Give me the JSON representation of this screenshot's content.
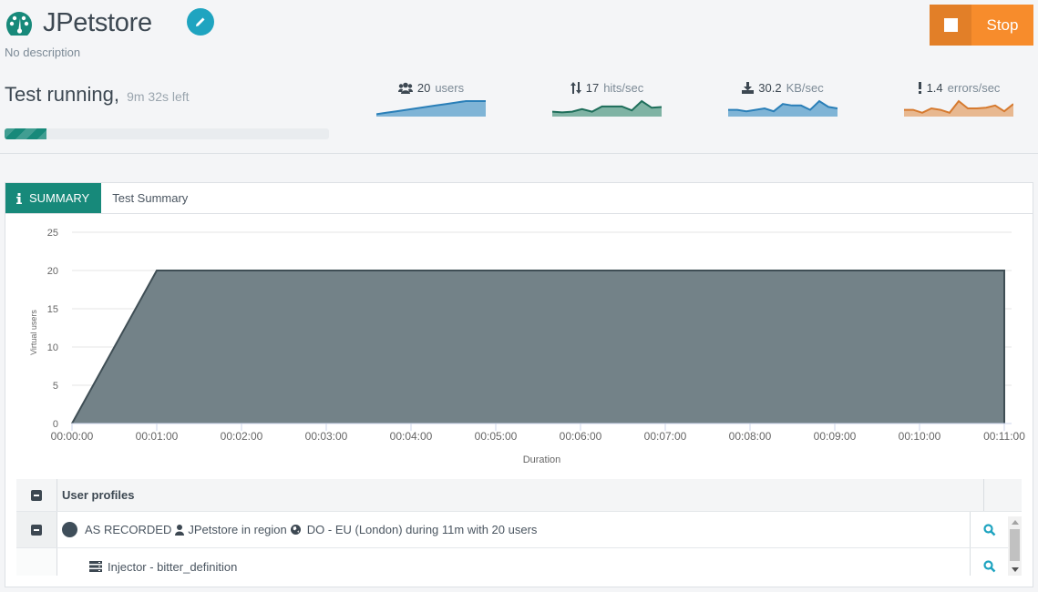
{
  "header": {
    "title": "JPetstore",
    "description": "No description",
    "status": "Test running,",
    "time_left": "9m 32s left",
    "progress_fraction": 0.13,
    "stop_label": "Stop"
  },
  "metrics": [
    {
      "value": "20",
      "unit": "users",
      "icon": "users-icon",
      "color": "#2a7fb8",
      "fill": "#7fb4d6",
      "spark": [
        1,
        2,
        3,
        4,
        5,
        6,
        7,
        8,
        9,
        10,
        10,
        10
      ]
    },
    {
      "value": "17",
      "unit": "hits/sec",
      "icon": "up-down-arrows-icon",
      "color": "#1e6e5a",
      "fill": "#7fb3a4",
      "spark": [
        3,
        2.5,
        3,
        5,
        3,
        7,
        7,
        7,
        4,
        11,
        6,
        6.5
      ]
    },
    {
      "value": "30.2",
      "unit": "KB/sec",
      "icon": "download-icon",
      "color": "#2a7fb8",
      "fill": "#7fb4d6",
      "spark": [
        4,
        4,
        3,
        4,
        5,
        3,
        8,
        7,
        7,
        4,
        10,
        6,
        5
      ]
    },
    {
      "value": "1.4",
      "unit": "errors/sec",
      "icon": "exclamation-icon",
      "color": "#d67a2f",
      "fill": "#e8b890",
      "spark": [
        4,
        4,
        2,
        5,
        4,
        2,
        10,
        5,
        5,
        5.5,
        7,
        3,
        8
      ]
    }
  ],
  "tabs": {
    "active_label": "SUMMARY",
    "title": "Test Summary"
  },
  "chart_data": {
    "type": "area",
    "title": "",
    "xlabel": "Duration",
    "ylabel": "Virtual users",
    "x_ticks": [
      "00:00:00",
      "00:01:00",
      "00:02:00",
      "00:03:00",
      "00:04:00",
      "00:05:00",
      "00:06:00",
      "00:07:00",
      "00:08:00",
      "00:09:00",
      "00:10:00",
      "00:11:00"
    ],
    "y_ticks": [
      0,
      5,
      10,
      15,
      20,
      25
    ],
    "ylim": [
      0,
      25
    ],
    "xlim_minutes": [
      0,
      11
    ],
    "points": [
      {
        "x_min": 0,
        "y": 0
      },
      {
        "x_min": 1,
        "y": 20
      },
      {
        "x_min": 11,
        "y": 20
      },
      {
        "x_min": 11,
        "y": 0
      }
    ],
    "grid": true,
    "fill_color": "#738288",
    "line_color": "#3f4e55"
  },
  "table": {
    "header": "User profiles",
    "rows": [
      {
        "population": "AS RECORDED",
        "scenario": "JPetstore in region",
        "region": "DO - EU (London) during 11m with 20 users"
      },
      {
        "injector": "Injector - bitter_definition"
      }
    ]
  }
}
